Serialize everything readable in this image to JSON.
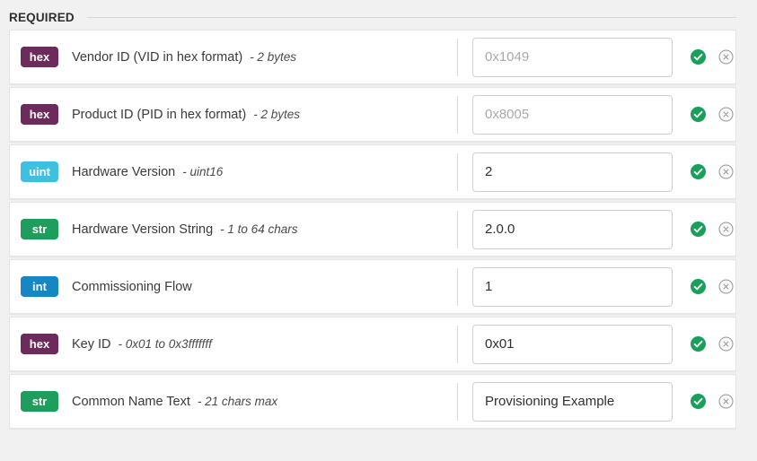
{
  "section": {
    "title": "REQUIRED"
  },
  "icons": {
    "valid": "check-circle-icon",
    "clear": "circle-x-icon"
  },
  "colors": {
    "badge_hex": "#6e2a5c",
    "badge_uint": "#40c0e0",
    "badge_str": "#1f9d5c",
    "badge_int": "#1787c4",
    "valid_green": "#18a05a",
    "clear_grey": "#999999",
    "page_background": "#f1f1f1",
    "row_background": "#ffffff"
  },
  "fields": [
    {
      "type": "hex",
      "type_class": "badge-hex",
      "label": "Vendor ID (VID in hex format)",
      "hint": "- 2 bytes",
      "value": "",
      "placeholder": "0x1049",
      "valid": true
    },
    {
      "type": "hex",
      "type_class": "badge-hex",
      "label": "Product ID (PID in hex format)",
      "hint": "- 2 bytes",
      "value": "",
      "placeholder": "0x8005",
      "valid": true
    },
    {
      "type": "uint",
      "type_class": "badge-uint",
      "label": "Hardware Version",
      "hint": "- uint16",
      "value": "2",
      "placeholder": "",
      "valid": true
    },
    {
      "type": "str",
      "type_class": "badge-str",
      "label": "Hardware Version String",
      "hint": "- 1 to 64 chars",
      "value": "2.0.0",
      "placeholder": "",
      "valid": true
    },
    {
      "type": "int",
      "type_class": "badge-int",
      "label": "Commissioning Flow",
      "hint": "",
      "value": "1",
      "placeholder": "",
      "valid": true
    },
    {
      "type": "hex",
      "type_class": "badge-hex",
      "label": "Key ID",
      "hint": "- 0x01 to 0x3fffffff",
      "value": "0x01",
      "placeholder": "",
      "valid": true
    },
    {
      "type": "str",
      "type_class": "badge-str",
      "label": "Common Name Text",
      "hint": "- 21 chars max",
      "value": "Provisioning Example",
      "placeholder": "",
      "valid": true
    }
  ]
}
